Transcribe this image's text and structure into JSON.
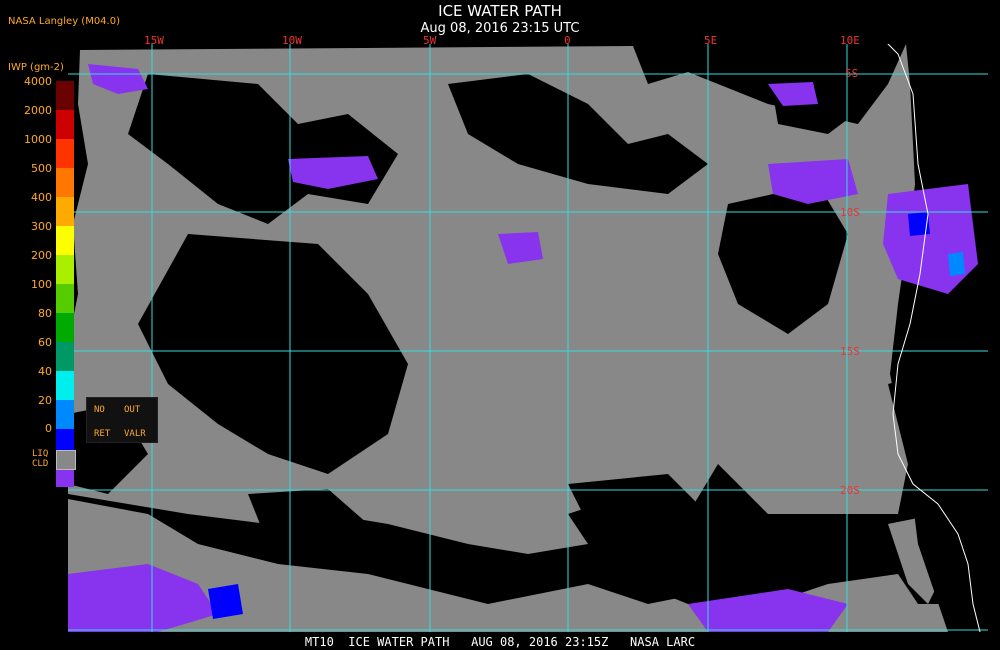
{
  "header": {
    "title": "ICE WATER PATH",
    "subtitle": "Aug 08, 2016 23:15 UTC",
    "producer": "NASA Langley (M04.0)"
  },
  "map": {
    "longitude_labels": [
      "15W",
      "10W",
      "5W",
      "0",
      "5E",
      "10E"
    ],
    "latitude_labels": [
      "5S",
      "10S",
      "15S",
      "20S"
    ],
    "grid_color": "#33dddd",
    "label_color": "#ee3333",
    "liquid_cloud_color": "#888888",
    "clear_color": "#000000",
    "coastline_color": "#ffffff"
  },
  "legend": {
    "title": "IWP (gm-2)",
    "ticks": [
      "4000",
      "2000",
      "1000",
      "500",
      "400",
      "300",
      "200",
      "100",
      "80",
      "60",
      "40",
      "20",
      "0"
    ],
    "colors": [
      "#6b0000",
      "#cc0000",
      "#ff3300",
      "#ff7700",
      "#ffaa00",
      "#ffff00",
      "#aaee00",
      "#55cc00",
      "#00aa00",
      "#009966",
      "#00eeee",
      "#0088ff",
      "#0000ff",
      "#0000aa",
      "#8833ee"
    ],
    "no_retrieval": [
      "NO",
      "RET"
    ],
    "out_of_range": [
      "OUT",
      "VALR"
    ],
    "liquid_cloud": [
      "LIQ",
      "CLD"
    ]
  },
  "footer": {
    "text": "MT10  ICE WATER PATH   AUG 08, 2016 23:15Z   NASA LARC"
  }
}
